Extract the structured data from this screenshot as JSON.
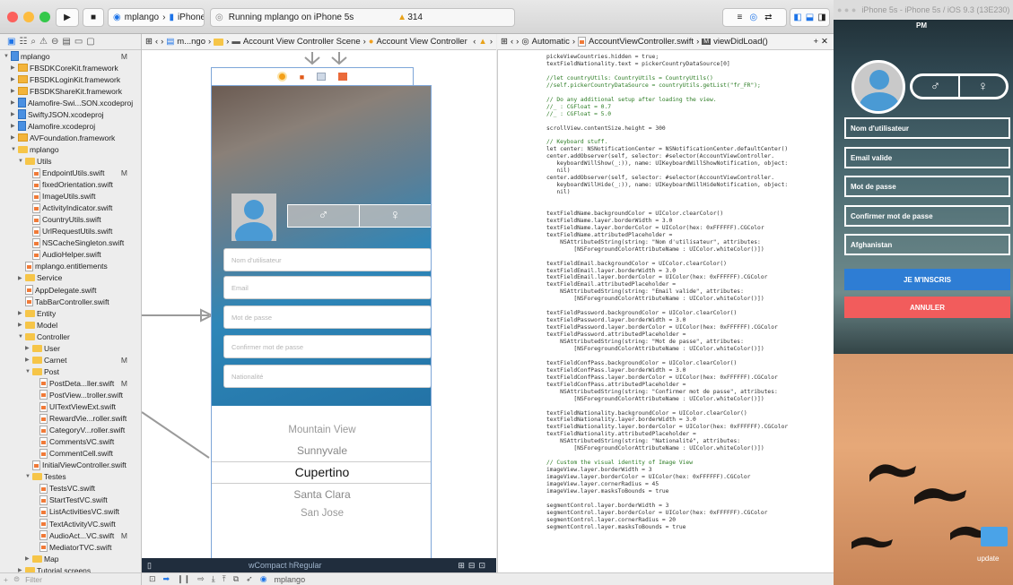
{
  "toolbar": {
    "scheme": "mplango",
    "device": "iPhone 5s",
    "status": "Running mplango on iPhone 5s",
    "warnings": "314"
  },
  "ib_jump": [
    "m...ngo",
    "Account View Controller Scene",
    "Account View Controller"
  ],
  "code_jump": [
    "Automatic",
    "AccountViewController.swift",
    "viewDidLoad()"
  ],
  "navigator": {
    "filter_placeholder": "Filter",
    "items": [
      {
        "label": "mplango",
        "level": 0,
        "kind": "proj",
        "open": true,
        "badge": "M"
      },
      {
        "label": "FBSDKCoreKit.framework",
        "level": 1,
        "kind": "fw",
        "open": false
      },
      {
        "label": "FBSDKLoginKit.framework",
        "level": 1,
        "kind": "fw",
        "open": false
      },
      {
        "label": "FBSDKShareKit.framework",
        "level": 1,
        "kind": "fw",
        "open": false
      },
      {
        "label": "Alamofire-Swi...SON.xcodeproj",
        "level": 1,
        "kind": "proj",
        "open": false
      },
      {
        "label": "SwiftyJSON.xcodeproj",
        "level": 1,
        "kind": "proj",
        "open": false
      },
      {
        "label": "Alamofire.xcodeproj",
        "level": 1,
        "kind": "proj",
        "open": false
      },
      {
        "label": "AVFoundation.framework",
        "level": 1,
        "kind": "fw",
        "open": false
      },
      {
        "label": "mplango",
        "level": 1,
        "kind": "folder",
        "open": true
      },
      {
        "label": "Utils",
        "level": 2,
        "kind": "folder",
        "open": true
      },
      {
        "label": "EndpointUtils.swift",
        "level": 3,
        "kind": "swift",
        "badge": "M"
      },
      {
        "label": "fixedOrientation.swift",
        "level": 3,
        "kind": "swift"
      },
      {
        "label": "ImageUtils.swift",
        "level": 3,
        "kind": "swift"
      },
      {
        "label": "ActivityIndicator.swift",
        "level": 3,
        "kind": "swift"
      },
      {
        "label": "CountryUtils.swift",
        "level": 3,
        "kind": "swift"
      },
      {
        "label": "UrlRequestUtils.swift",
        "level": 3,
        "kind": "swift"
      },
      {
        "label": "NSCacheSingleton.swift",
        "level": 3,
        "kind": "swift"
      },
      {
        "label": "AudioHelper.swift",
        "level": 3,
        "kind": "swift"
      },
      {
        "label": "mplango.entitlements",
        "level": 2,
        "kind": "doc"
      },
      {
        "label": "Service",
        "level": 2,
        "kind": "folder",
        "open": false
      },
      {
        "label": "AppDelegate.swift",
        "level": 2,
        "kind": "swift"
      },
      {
        "label": "TabBarController.swift",
        "level": 2,
        "kind": "swift"
      },
      {
        "label": "Entity",
        "level": 2,
        "kind": "folder",
        "open": false
      },
      {
        "label": "Model",
        "level": 2,
        "kind": "folder",
        "open": false
      },
      {
        "label": "Controller",
        "level": 2,
        "kind": "folder",
        "open": true
      },
      {
        "label": "User",
        "level": 3,
        "kind": "folder",
        "open": false
      },
      {
        "label": "Carnet",
        "level": 3,
        "kind": "folder",
        "open": false,
        "badge": "M"
      },
      {
        "label": "Post",
        "level": 3,
        "kind": "folder",
        "open": true
      },
      {
        "label": "PostDeta...ller.swift",
        "level": 4,
        "kind": "swift",
        "badge": "M"
      },
      {
        "label": "PostView...troller.swift",
        "level": 4,
        "kind": "swift"
      },
      {
        "label": "UITextViewExt.swift",
        "level": 4,
        "kind": "swift"
      },
      {
        "label": "RewardVie...roller.swift",
        "level": 4,
        "kind": "swift"
      },
      {
        "label": "CategoryV...roller.swift",
        "level": 4,
        "kind": "swift"
      },
      {
        "label": "CommentsVC.swift",
        "level": 4,
        "kind": "swift"
      },
      {
        "label": "CommentCell.swift",
        "level": 4,
        "kind": "swift"
      },
      {
        "label": "InitialViewController.swift",
        "level": 3,
        "kind": "swift"
      },
      {
        "label": "Testes",
        "level": 3,
        "kind": "folder",
        "open": true
      },
      {
        "label": "TestsVC.swift",
        "level": 4,
        "kind": "swift"
      },
      {
        "label": "StartTestVC.swift",
        "level": 4,
        "kind": "swift"
      },
      {
        "label": "ListActivitiesVC.swift",
        "level": 4,
        "kind": "swift"
      },
      {
        "label": "TextActivityVC.swift",
        "level": 4,
        "kind": "swift"
      },
      {
        "label": "AudioAct...VC.swift",
        "level": 4,
        "kind": "swift",
        "badge": "M"
      },
      {
        "label": "MediatorTVC.swift",
        "level": 4,
        "kind": "swift"
      },
      {
        "label": "Map",
        "level": 3,
        "kind": "folder",
        "open": false
      },
      {
        "label": "Tutorial screens",
        "level": 2,
        "kind": "folder",
        "open": false
      }
    ]
  },
  "storyboard": {
    "fields": [
      "Nom d'utilisateur",
      "Email",
      "Mot de passe",
      "Confirmer mot de passe",
      "Nationalité"
    ],
    "picker": [
      "Mountain View",
      "Sunnyvale",
      "Cupertino",
      "Santa Clara",
      "San Jose"
    ],
    "size_class": "wCompact hRegular"
  },
  "code_lines": [
    "pickeViewCountries.hidden = true;",
    "textFieldNationality.text = pickerCountryDataSource[0]",
    "",
    "//let countryUtils: CountryUtils = CountryUtils()",
    "//self.pickerCountryDataSource = countryUtils.getList(\"fr_FR\");",
    "",
    "// Do any additional setup after loading the view.",
    "//_ : CGFloat = 0.7",
    "//_ : CGFloat = 5.0",
    "",
    "scrollView.contentSize.height = 300",
    "",
    "// Keyboard stuff.",
    "let center: NSNotificationCenter = NSNotificationCenter.defaultCenter()",
    "center.addObserver(self, selector: #selector(AccountViewController.",
    "   keyboardWillShow(_:)), name: UIKeyboardWillShowNotification, object:",
    "   nil)",
    "center.addObserver(self, selector: #selector(AccountViewController.",
    "   keyboardWillHide(_:)), name: UIKeyboardWillHideNotification, object:",
    "   nil)",
    "",
    "",
    "textFieldName.backgroundColor = UIColor.clearColor()",
    "textFieldName.layer.borderWidth = 3.0",
    "textFieldName.layer.borderColor = UIColor(hex: 0xFFFFFF).CGColor",
    "textFieldName.attributedPlaceholder =",
    "    NSAttributedString(string: \"Nom d'utilisateur\", attributes:",
    "        [NSForegroundColorAttributeName : UIColor.whiteColor()])",
    "",
    "textFieldEmail.backgroundColor = UIColor.clearColor()",
    "textFieldEmail.layer.borderWidth = 3.0",
    "textFieldEmail.layer.borderColor = UIColor(hex: 0xFFFFFF).CGColor",
    "textFieldEmail.attributedPlaceholder =",
    "    NSAttributedString(string: \"Email valide\", attributes:",
    "        [NSForegroundColorAttributeName : UIColor.whiteColor()])",
    "",
    "textFieldPassword.backgroundColor = UIColor.clearColor()",
    "textFieldPassword.layer.borderWidth = 3.0",
    "textFieldPassword.layer.borderColor = UIColor(hex: 0xFFFFFF).CGColor",
    "textFieldPassword.attributedPlaceholder =",
    "    NSAttributedString(string: \"Mot de passe\", attributes:",
    "        [NSForegroundColorAttributeName : UIColor.whiteColor()])",
    "",
    "textFieldConfPass.backgroundColor = UIColor.clearColor()",
    "textFieldConfPass.layer.borderWidth = 3.0",
    "textFieldConfPass.layer.borderColor = UIColor(hex: 0xFFFFFF).CGColor",
    "textFieldConfPass.attributedPlaceholder =",
    "    NSAttributedString(string: \"Confirmer mot de passe\", attributes:",
    "        [NSForegroundColorAttributeName : UIColor.whiteColor()])",
    "",
    "textFieldNationality.backgroundColor = UIColor.clearColor()",
    "textFieldNationality.layer.borderWidth = 3.0",
    "textFieldNationality.layer.borderColor = UIColor(hex: 0xFFFFFF).CGColor",
    "textFieldNationality.attributedPlaceholder =",
    "    NSAttributedString(string: \"Nationalité\", attributes:",
    "        [NSForegroundColorAttributeName : UIColor.whiteColor()])",
    "",
    "// Custom the visual identity of Image View",
    "imageView.layer.borderWidth = 3",
    "imageView.layer.borderColor = UIColor(hex: 0xFFFFFF).CGColor",
    "imageView.layer.cornerRadius = 45",
    "imageView.layer.masksToBounds = true",
    "",
    "segmentControl.layer.borderWidth = 3",
    "segmentControl.layer.borderColor = UIColor(hex: 0xFFFFFF).CGColor",
    "segmentControl.layer.cornerRadius = 20",
    "segmentControl.layer.masksToBounds = true"
  ],
  "simulator": {
    "title": "iPhone 5s - iPhone 5s / iOS 9.3 (13E230)",
    "time": "PM",
    "fields": [
      "Nom d'utilisateur",
      "Email valide",
      "Mot de passe",
      "Confirmer mot de passe",
      "Afghanistan"
    ],
    "signup": "JE M'INSCRIS",
    "cancel": "ANNULER",
    "update": "update"
  },
  "debug": {
    "target": "mplango"
  },
  "colors": {
    "blue_btn": "#2e7dd4",
    "red_btn": "#f25c5c",
    "selection": "#1c73e8"
  }
}
